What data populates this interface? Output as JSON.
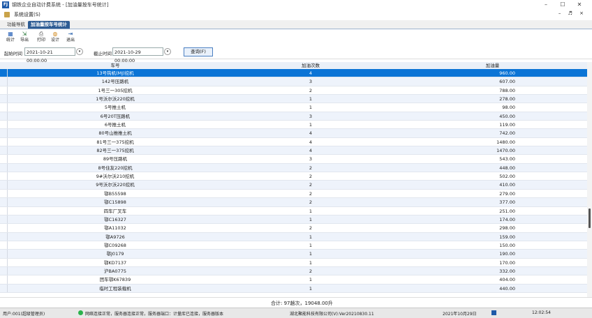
{
  "window": {
    "title": "钢铁企业自动计费系统 - [加油量按车号统计]",
    "app_icon": "FJ",
    "controls": [
      "–",
      "☐",
      "✕"
    ]
  },
  "menubar": {
    "item": "系统设置(S)",
    "mdi_controls": "– ♬ ×"
  },
  "tabs": {
    "inactive": "功能导航",
    "active": "加油量按车号统计"
  },
  "toolbar": [
    {
      "label": "统计",
      "icon": "stats-icon",
      "glyph": "▦"
    },
    {
      "label": "导出",
      "icon": "export-icon",
      "glyph": "⇲"
    },
    {
      "label": "打印",
      "icon": "print-icon",
      "glyph": "⎙"
    },
    {
      "label": "设计",
      "icon": "design-icon",
      "glyph": "◍"
    },
    {
      "label": "退出",
      "icon": "exit-icon",
      "glyph": "⇥"
    }
  ],
  "filter": {
    "start_label": "起始时间",
    "start_value": "2021-10-21 00:00:00",
    "end_label": "截止时间",
    "end_value": "2021-10-29 00:00:00",
    "query_button": "查询(F)"
  },
  "grid": {
    "columns": [
      "车号",
      "加油次数",
      "加油量"
    ],
    "rows": [
      [
        "13号钩机(MJ)挖机",
        "4",
        "960.00"
      ],
      [
        "142号压路机",
        "3",
        "607.00"
      ],
      [
        "1号三一305挖机",
        "2",
        "788.00"
      ],
      [
        "1号沃尔沃220挖机",
        "1",
        "278.00"
      ],
      [
        "5号推土机",
        "1",
        "98.00"
      ],
      [
        "6号20T压路机",
        "3",
        "450.00"
      ],
      [
        "6号推土机",
        "1",
        "119.00"
      ],
      [
        "80号山推推土机",
        "4",
        "742.00"
      ],
      [
        "81号三一375挖机",
        "4",
        "1480.00"
      ],
      [
        "82号三一375挖机",
        "4",
        "1470.00"
      ],
      [
        "89号压路机",
        "3",
        "543.00"
      ],
      [
        "8号住友220挖机",
        "2",
        "448.00"
      ],
      [
        "9#沃尔沃210挖机",
        "2",
        "502.00"
      ],
      [
        "9号沃尔沃220挖机",
        "2",
        "410.00"
      ],
      [
        "鄂B55598",
        "2",
        "279.00"
      ],
      [
        "鄂C15898",
        "2",
        "377.00"
      ],
      [
        "四车厂叉车",
        "1",
        "251.00"
      ],
      [
        "鄂C16327",
        "1",
        "174.00"
      ],
      [
        "鄂A11032",
        "2",
        "298.00"
      ],
      [
        "鄂A9726",
        "1",
        "159.00"
      ],
      [
        "鄂C09268",
        "1",
        "150.00"
      ],
      [
        "鄂J0179",
        "1",
        "190.00"
      ],
      [
        "鄂KD7137",
        "1",
        "170.00"
      ],
      [
        "沪BA0775",
        "2",
        "332.00"
      ],
      [
        "团车鄂K67839",
        "1",
        "404.00"
      ],
      [
        "临时工程装载机",
        "1",
        "440.00"
      ]
    ],
    "selected_row": 0
  },
  "footer": {
    "summary": "合计: 97趟次，19048.00升"
  },
  "statusbar": {
    "user": "用户:001(超级管理员)",
    "server": "网络连接正常，服务器连接正常，服务器端口：计量库已连接，服务器版本",
    "company": "湖北聚能科技有限公司(V):Ver20210830.11",
    "date": "2021年10月29日",
    "time": "12:02:54"
  }
}
